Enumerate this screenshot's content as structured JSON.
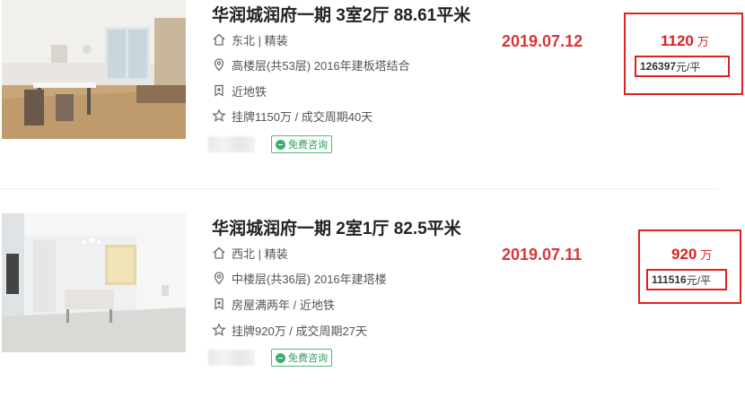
{
  "listings": [
    {
      "title": "华润城润府一期 3室2厅 88.61平米",
      "orientation": "东北 | 精装",
      "floor": "高楼层(共53层) 2016年建板塔结合",
      "features": "近地铁",
      "listing_info": "挂牌1150万 / 成交周期40天",
      "consult_label": "免费咨询",
      "deal_date": "2019.07.12",
      "total_price": "1120",
      "total_unit": "万",
      "unit_price": "126397",
      "unit_price_suffix": "元/平"
    },
    {
      "title": "华润城润府一期 2室1厅 82.5平米",
      "orientation": "西北 | 精装",
      "floor": "中楼层(共36层) 2016年建塔楼",
      "features": "房屋满两年 / 近地铁",
      "listing_info": "挂牌920万 / 成交周期27天",
      "consult_label": "免费咨询",
      "deal_date": "2019.07.11",
      "total_price": "920",
      "total_unit": "万",
      "unit_price": "111516",
      "unit_price_suffix": "元/平"
    }
  ],
  "icons": {
    "orientation": "home-icon",
    "floor": "location-pin-icon",
    "features": "tag-shield-icon",
    "listing_info": "star-icon"
  },
  "colors": {
    "accent_red": "#d8363b",
    "highlight_box": "#e02020",
    "consult_green": "#2f9a5c"
  }
}
